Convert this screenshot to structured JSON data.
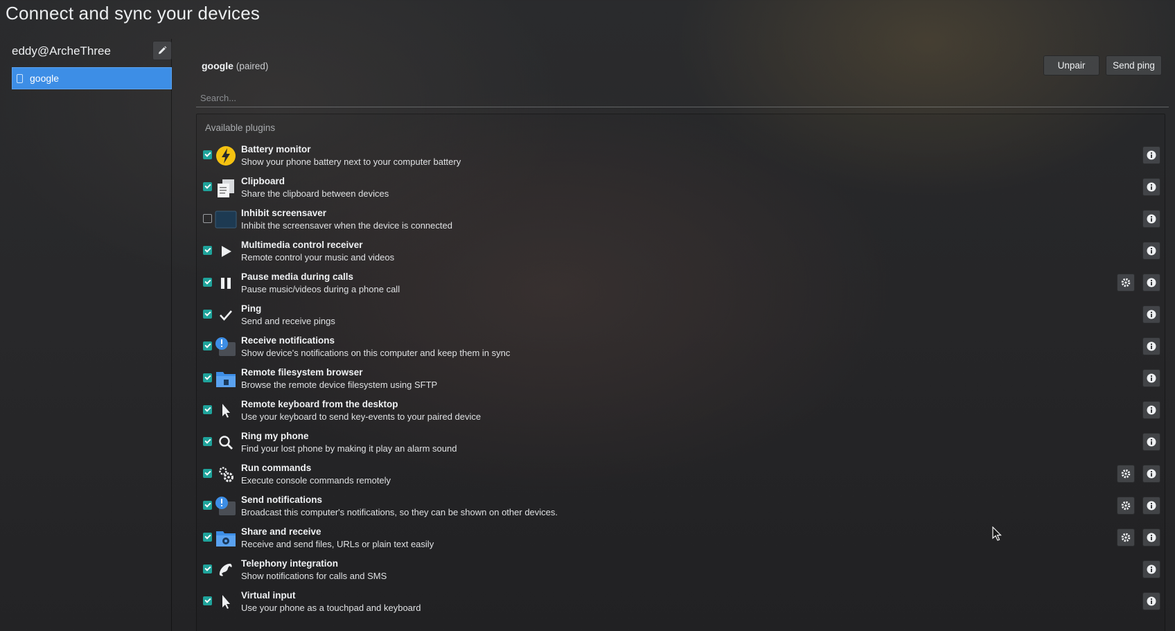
{
  "page": {
    "title": "Connect and sync your devices"
  },
  "sidebar": {
    "host_name": "eddy@ArcheThree",
    "devices": [
      {
        "label": "google",
        "selected": true
      }
    ]
  },
  "device": {
    "name": "google",
    "status": "(paired)",
    "unpair_label": "Unpair",
    "send_ping_label": "Send ping"
  },
  "search": {
    "placeholder": "Search..."
  },
  "plugins": {
    "header": "Available plugins",
    "items": [
      {
        "title": "Battery monitor",
        "desc": "Show your phone battery next to your computer battery",
        "enabled": true,
        "icon": "battery-icon",
        "configurable": false
      },
      {
        "title": "Clipboard",
        "desc": "Share the clipboard between devices",
        "enabled": true,
        "icon": "clipboard-icon",
        "configurable": false
      },
      {
        "title": "Inhibit screensaver",
        "desc": "Inhibit the screensaver when the device is connected",
        "enabled": false,
        "icon": "screensaver-icon",
        "configurable": false
      },
      {
        "title": "Multimedia control receiver",
        "desc": "Remote control your music and videos",
        "enabled": true,
        "icon": "play-icon",
        "configurable": false
      },
      {
        "title": "Pause media during calls",
        "desc": "Pause music/videos during a phone call",
        "enabled": true,
        "icon": "pause-icon",
        "configurable": true
      },
      {
        "title": "Ping",
        "desc": "Send and receive pings",
        "enabled": true,
        "icon": "checkmark-icon",
        "configurable": false
      },
      {
        "title": "Receive notifications",
        "desc": "Show device's notifications on this computer and keep them in sync",
        "enabled": true,
        "icon": "notification-icon",
        "configurable": false
      },
      {
        "title": "Remote filesystem browser",
        "desc": "Browse the remote device filesystem using SFTP",
        "enabled": true,
        "icon": "folder-icon",
        "configurable": false
      },
      {
        "title": "Remote keyboard from the desktop",
        "desc": "Use your keyboard to send key-events to your paired device",
        "enabled": true,
        "icon": "pointer-icon",
        "configurable": false
      },
      {
        "title": "Ring my phone",
        "desc": "Find your lost phone by making it play an alarm sound",
        "enabled": true,
        "icon": "magnifier-icon",
        "configurable": false
      },
      {
        "title": "Run commands",
        "desc": "Execute console commands remotely",
        "enabled": true,
        "icon": "gears-icon",
        "configurable": true
      },
      {
        "title": "Send notifications",
        "desc": "Broadcast this computer's notifications, so they can be shown on other devices.",
        "enabled": true,
        "icon": "notification-icon",
        "configurable": true
      },
      {
        "title": "Share and receive",
        "desc": "Receive and send files, URLs or plain text easily",
        "enabled": true,
        "icon": "folder-share-icon",
        "configurable": true
      },
      {
        "title": "Telephony integration",
        "desc": "Show notifications for calls and SMS",
        "enabled": true,
        "icon": "phone-icon",
        "configurable": false
      },
      {
        "title": "Virtual input",
        "desc": "Use your phone as a touchpad and keyboard",
        "enabled": true,
        "icon": "pointer-icon",
        "configurable": false
      }
    ]
  },
  "colors": {
    "accent": "#3d8ee6",
    "checkbox": "#1fa39b",
    "battery": "#f5c211"
  }
}
